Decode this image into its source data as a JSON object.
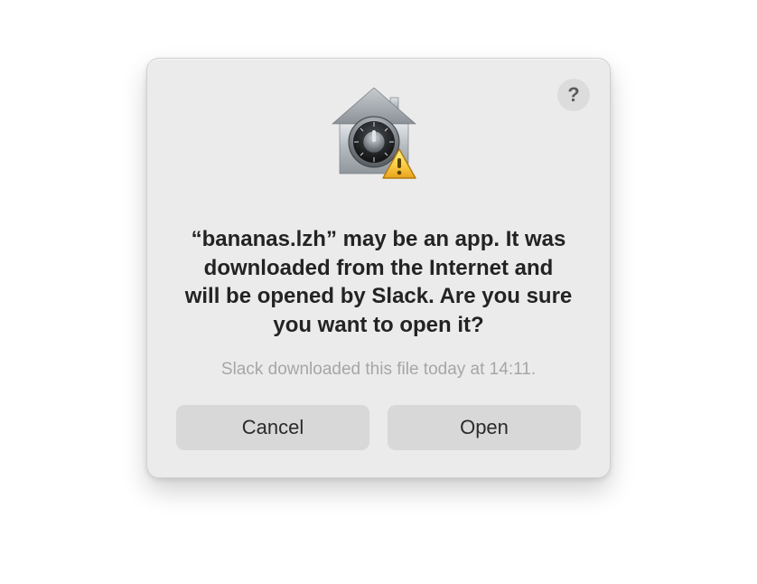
{
  "dialog": {
    "heading": "“bananas.lzh” may be an app. It was downloaded from the Internet and will be opened by Slack. Are you sure you want to open it?",
    "subtext": "Slack downloaded this file today at 14:11.",
    "buttons": {
      "cancel": "Cancel",
      "open": "Open"
    },
    "help_glyph": "?"
  },
  "icons": {
    "main": "gatekeeper-warning",
    "help": "help-icon"
  }
}
